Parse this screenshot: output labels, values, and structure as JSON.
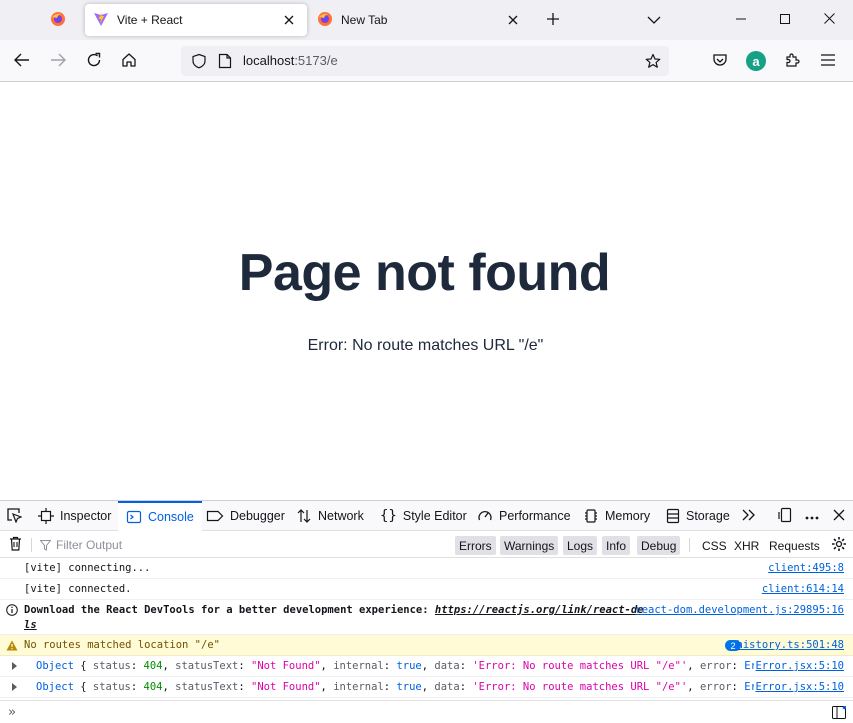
{
  "browser": {
    "tabs": [
      {
        "title": "Vite + React",
        "active": true
      },
      {
        "title": "New Tab",
        "active": false
      }
    ],
    "url_host": "localhost",
    "url_rest": ":5173/e",
    "account_initial": "a"
  },
  "page": {
    "heading": "Page not found",
    "error": "Error: No route matches URL \"/e\""
  },
  "devtools": {
    "tabs": [
      "Inspector",
      "Console",
      "Debugger",
      "Network",
      "Style Editor",
      "Performance",
      "Memory",
      "Storage"
    ],
    "selected_tab": "Console",
    "filter_placeholder": "Filter Output",
    "filters": [
      "Errors",
      "Warnings",
      "Logs",
      "Info",
      "Debug",
      "CSS",
      "XHR",
      "Requests"
    ],
    "messages": {
      "m1_text": "[vite] connecting...",
      "m1_src": "client:495:8",
      "m2_text": "[vite] connected.",
      "m2_src": "client:614:14",
      "m3_text": "Download the React DevTools for a better development experience: ",
      "m3_link": "https://reactjs.org/link/react-devtoo",
      "m3_link2": "ls",
      "m3_src": "react-dom.development.js:29895:16",
      "m4_text": "No routes matched location \"/e\"",
      "m4_count": "2",
      "m4_src": "history.ts:501:48",
      "obj_src": "Error.jsx:5:10"
    },
    "object_line": {
      "kw": "Object",
      "open": " { ",
      "k_status": "status",
      "v_status": "404",
      "k_statusText": "statusText",
      "v_statusText": "\"Not Found\"",
      "k_internal": "internal",
      "v_internal": "true",
      "k_data": "data",
      "v_data": "'Error: No route matches URL \"/e\"'",
      "k_error": "error",
      "v_error": "Error",
      "close": " }"
    },
    "prompt": "»"
  },
  "colors": {
    "heading": "#1e293b",
    "accent": "#0061e0",
    "warn_bg": "#fffbd6"
  }
}
